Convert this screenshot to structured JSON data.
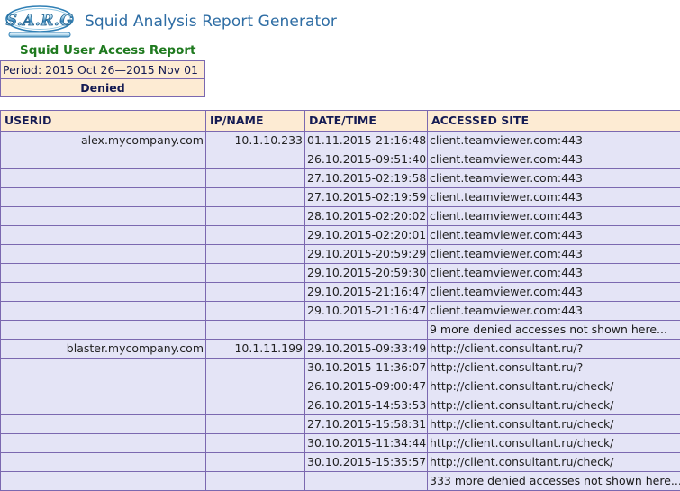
{
  "app": {
    "logo_text": "SARG",
    "logo_name": "sarg-logo",
    "title": "Squid Analysis Report Generator"
  },
  "report": {
    "title": "Squid User Access Report",
    "period": "Period: 2015 Oct 26—2015 Nov 01",
    "label": "Denied"
  },
  "table": {
    "columns": [
      "USERID",
      "IP/NAME",
      "DATE/TIME",
      "ACCESSED SITE"
    ],
    "rows": [
      {
        "userid": "alex.mycompany.com",
        "ip": "10.1.10.233",
        "datetime": "01.11.2015-21:16:48",
        "site": "client.teamviewer.com:443",
        "is_link": true
      },
      {
        "userid": "",
        "ip": "",
        "datetime": "26.10.2015-09:51:40",
        "site": "client.teamviewer.com:443",
        "is_link": true
      },
      {
        "userid": "",
        "ip": "",
        "datetime": "27.10.2015-02:19:58",
        "site": "client.teamviewer.com:443",
        "is_link": true
      },
      {
        "userid": "",
        "ip": "",
        "datetime": "27.10.2015-02:19:59",
        "site": "client.teamviewer.com:443",
        "is_link": true
      },
      {
        "userid": "",
        "ip": "",
        "datetime": "28.10.2015-02:20:02",
        "site": "client.teamviewer.com:443",
        "is_link": true
      },
      {
        "userid": "",
        "ip": "",
        "datetime": "29.10.2015-02:20:01",
        "site": "client.teamviewer.com:443",
        "is_link": true
      },
      {
        "userid": "",
        "ip": "",
        "datetime": "29.10.2015-20:59:29",
        "site": "client.teamviewer.com:443",
        "is_link": true
      },
      {
        "userid": "",
        "ip": "",
        "datetime": "29.10.2015-20:59:30",
        "site": "client.teamviewer.com:443",
        "is_link": true
      },
      {
        "userid": "",
        "ip": "",
        "datetime": "29.10.2015-21:16:47",
        "site": "client.teamviewer.com:443",
        "is_link": true
      },
      {
        "userid": "",
        "ip": "",
        "datetime": "29.10.2015-21:16:47",
        "site": "client.teamviewer.com:443",
        "is_link": true
      },
      {
        "userid": "",
        "ip": "",
        "datetime": "",
        "site": "9 more denied accesses not shown here...",
        "is_link": false
      },
      {
        "userid": "blaster.mycompany.com",
        "ip": "10.1.11.199",
        "datetime": "29.10.2015-09:33:49",
        "site": "http://client.consultant.ru/?",
        "is_link": true
      },
      {
        "userid": "",
        "ip": "",
        "datetime": "30.10.2015-11:36:07",
        "site": "http://client.consultant.ru/?",
        "is_link": true
      },
      {
        "userid": "",
        "ip": "",
        "datetime": "26.10.2015-09:00:47",
        "site": "http://client.consultant.ru/check/",
        "is_link": true
      },
      {
        "userid": "",
        "ip": "",
        "datetime": "26.10.2015-14:53:53",
        "site": "http://client.consultant.ru/check/",
        "is_link": true
      },
      {
        "userid": "",
        "ip": "",
        "datetime": "27.10.2015-15:58:31",
        "site": "http://client.consultant.ru/check/",
        "is_link": true
      },
      {
        "userid": "",
        "ip": "",
        "datetime": "30.10.2015-11:34:44",
        "site": "http://client.consultant.ru/check/",
        "is_link": true
      },
      {
        "userid": "",
        "ip": "",
        "datetime": "30.10.2015-15:35:57",
        "site": "http://client.consultant.ru/check/",
        "is_link": true
      },
      {
        "userid": "",
        "ip": "",
        "datetime": "",
        "site": "333 more denied accesses not shown here...",
        "is_link": false
      }
    ]
  },
  "colors": {
    "header_bg": "#fdebd3",
    "row_bg": "#e4e4f6",
    "border": "#7b68b0",
    "link": "#3b3bdd",
    "title_blue": "#2e6da4",
    "report_green": "#1f7a1f",
    "header_text": "#151b54"
  }
}
